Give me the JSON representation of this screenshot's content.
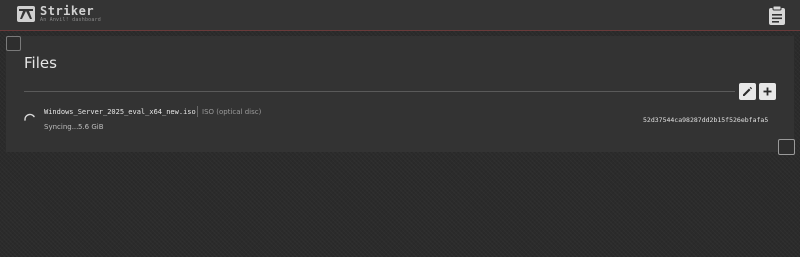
{
  "header": {
    "title": "Striker",
    "subtitle": "An Anvil! dashboard",
    "logo_icon": "anvil-logo-icon",
    "right_icon": "clipboard-icon"
  },
  "panel": {
    "title": "Files",
    "actions": [
      {
        "name": "edit",
        "icon": "pencil-icon"
      },
      {
        "name": "add",
        "icon": "plus-icon"
      }
    ]
  },
  "files": [
    {
      "name": "Windows_Server_2025_eval_x64_new.iso",
      "type": "ISO (optical disc)",
      "status": "Syncing...",
      "size": "5.6 GiB",
      "checksum": "52d37544ca98287dd2b15f526ebfafa5"
    }
  ],
  "colors": {
    "background": "#2b2b2b",
    "header": "#343434",
    "panel": "#333333",
    "accent_line": "#6a3a3a",
    "button": "#e8e8e8"
  }
}
